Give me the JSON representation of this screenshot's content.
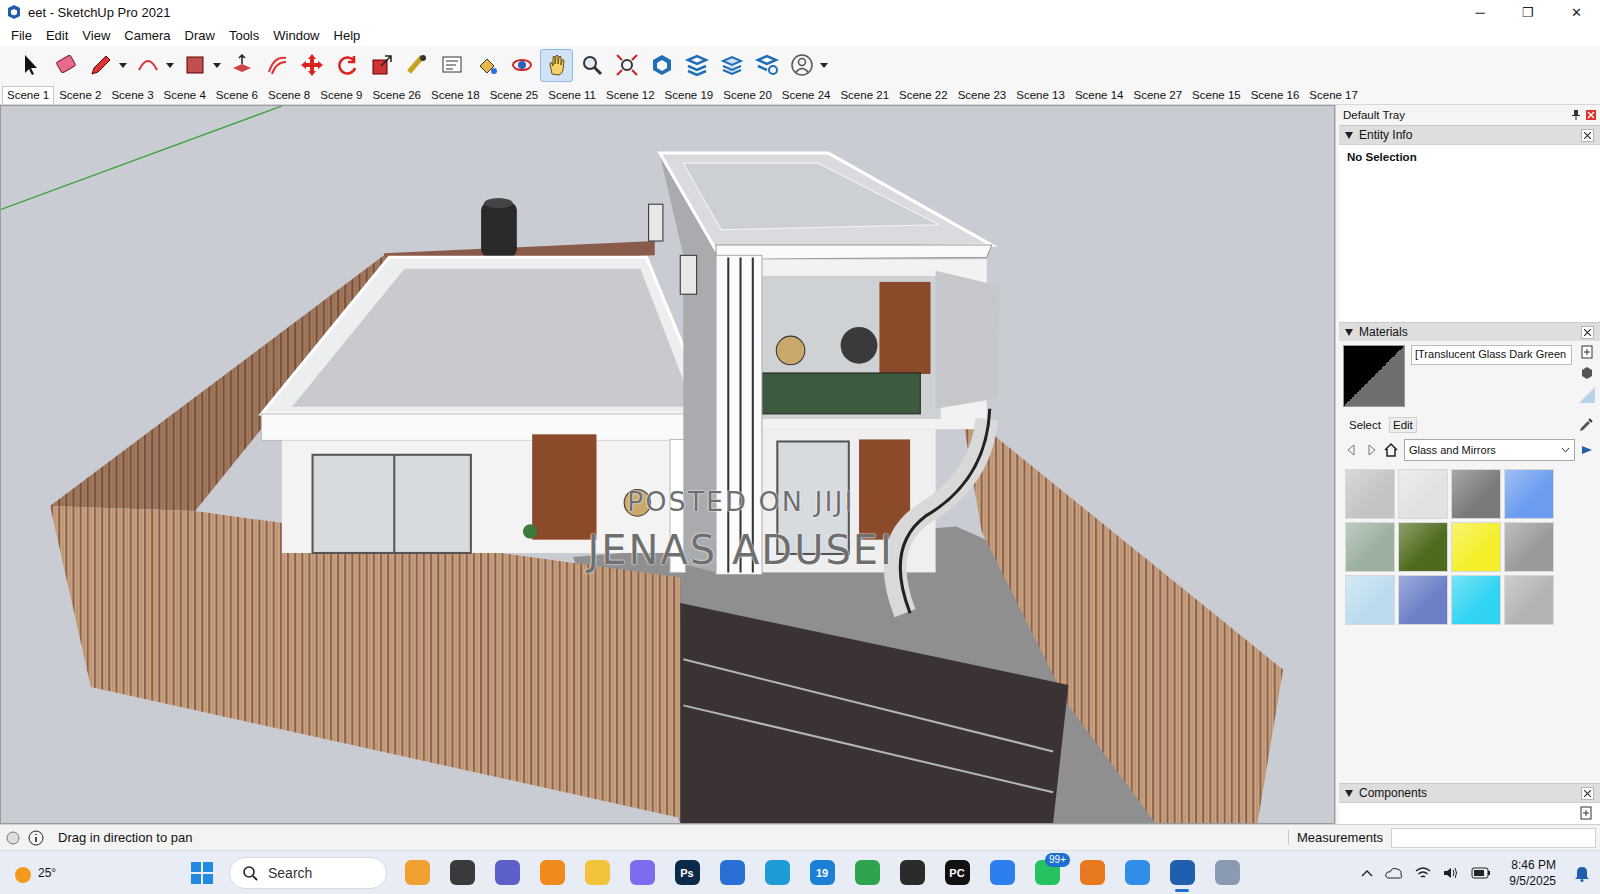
{
  "window": {
    "title": "eet - SketchUp Pro 2021",
    "controls": [
      "─",
      "❐",
      "✕"
    ]
  },
  "menu": [
    "File",
    "Edit",
    "View",
    "Camera",
    "Draw",
    "Tools",
    "Window",
    "Help"
  ],
  "toolbar": {
    "tools": [
      {
        "kind": "select",
        "selected": false,
        "has_menu": false
      },
      {
        "kind": "eraser",
        "selected": false,
        "has_menu": false
      },
      {
        "kind": "pencil",
        "selected": false,
        "has_menu": true
      },
      {
        "kind": "arc",
        "selected": false,
        "has_menu": true
      },
      {
        "kind": "rectangle",
        "selected": false,
        "has_menu": true
      },
      {
        "kind": "pushpull",
        "selected": false,
        "has_menu": false
      },
      {
        "kind": "offset",
        "selected": false,
        "has_menu": false
      },
      {
        "kind": "move",
        "selected": false,
        "has_menu": false
      },
      {
        "kind": "rotate",
        "selected": false,
        "has_menu": false
      },
      {
        "kind": "scale",
        "selected": false,
        "has_menu": false
      },
      {
        "kind": "tape",
        "selected": false,
        "has_menu": false
      },
      {
        "kind": "text",
        "selected": false,
        "has_menu": false
      },
      {
        "kind": "paint",
        "selected": false,
        "has_menu": false
      },
      {
        "kind": "orbit",
        "selected": false,
        "has_menu": false
      },
      {
        "kind": "pan",
        "selected": true,
        "has_menu": false
      },
      {
        "kind": "zoom",
        "selected": false,
        "has_menu": false
      },
      {
        "kind": "zoom-extents",
        "selected": false,
        "has_menu": false
      },
      {
        "kind": "warehouse",
        "selected": false,
        "has_menu": false
      },
      {
        "kind": "extensions",
        "selected": false,
        "has_menu": false
      },
      {
        "kind": "layers",
        "selected": false,
        "has_menu": false
      },
      {
        "kind": "extension-manager",
        "selected": false,
        "has_menu": false
      },
      {
        "kind": "account",
        "selected": false,
        "has_menu": true
      }
    ]
  },
  "scenes": [
    {
      "label": "Scene 1",
      "selected": true
    },
    {
      "label": "Scene 2",
      "selected": false
    },
    {
      "label": "Scene 3",
      "selected": false
    },
    {
      "label": "Scene 4",
      "selected": false
    },
    {
      "label": "Scene 6",
      "selected": false
    },
    {
      "label": "Scene 8",
      "selected": false
    },
    {
      "label": "Scene 9",
      "selected": false
    },
    {
      "label": "Scene 26",
      "selected": false
    },
    {
      "label": "Scene 18",
      "selected": false
    },
    {
      "label": "Scene 25",
      "selected": false
    },
    {
      "label": "Scene 11",
      "selected": false
    },
    {
      "label": "Scene 12",
      "selected": false
    },
    {
      "label": "Scene 19",
      "selected": false
    },
    {
      "label": "Scene 20",
      "selected": false
    },
    {
      "label": "Scene 24",
      "selected": false
    },
    {
      "label": "Scene 21",
      "selected": false
    },
    {
      "label": "Scene 22",
      "selected": false
    },
    {
      "label": "Scene 23",
      "selected": false
    },
    {
      "label": "Scene 13",
      "selected": false
    },
    {
      "label": "Scene 14",
      "selected": false
    },
    {
      "label": "Scene 27",
      "selected": false
    },
    {
      "label": "Scene 15",
      "selected": false
    },
    {
      "label": "Scene 16",
      "selected": false
    },
    {
      "label": "Scene 17",
      "selected": false
    }
  ],
  "watermark": [
    "POSTED ON JIJI",
    "JENAS ADUSEI"
  ],
  "tray": {
    "title": "Default Tray",
    "entity_info": {
      "title": "Entity Info",
      "selection": "No Selection"
    },
    "materials": {
      "title": "Materials",
      "current": "[Translucent Glass Dark Green",
      "tabs": [
        {
          "label": "Select",
          "selected": true
        },
        {
          "label": "Edit",
          "selected": false
        }
      ],
      "library": "Glass and Mirrors",
      "swatches": [
        {
          "color": "#c4c4c4"
        },
        {
          "color": "#e2e2e2"
        },
        {
          "color": "#7a7a7a"
        },
        {
          "color": "#6c9cf0"
        },
        {
          "color": "#9bb09f"
        },
        {
          "color": "#4e6b1d"
        },
        {
          "color": "#f4ef2a"
        },
        {
          "color": "#9a9a9a"
        },
        {
          "color": "#bcdcee"
        },
        {
          "color": "#6b7ec6"
        },
        {
          "color": "#31d3f2"
        },
        {
          "color": "#b3b3b3"
        }
      ]
    },
    "components": {
      "title": "Components"
    }
  },
  "status_bar": {
    "hint": "Drag in direction to pan",
    "measurements_label": "Measurements"
  },
  "taskbar": {
    "weather": "25°",
    "search": "Search",
    "apps": [
      {
        "kind": "people",
        "color": "#f0a030",
        "label": "",
        "selected": false,
        "badge": ""
      },
      {
        "kind": "task-view",
        "color": "#3a3a3a",
        "label": "",
        "selected": false,
        "badge": ""
      },
      {
        "kind": "meet",
        "color": "#5b5fc7",
        "label": "",
        "selected": false,
        "badge": ""
      },
      {
        "kind": "vlc",
        "color": "#f08a1c",
        "label": "",
        "selected": false,
        "badge": ""
      },
      {
        "kind": "file-explorer",
        "color": "#f3c33b",
        "label": "",
        "selected": false,
        "badge": ""
      },
      {
        "kind": "copilot",
        "color": "#7e6cf0",
        "label": "",
        "selected": false,
        "badge": ""
      },
      {
        "kind": "photoshop",
        "color": "#0b2a4a",
        "label": "Ps",
        "selected": false,
        "badge": ""
      },
      {
        "kind": "store",
        "color": "#2a6fd6",
        "label": "",
        "selected": false,
        "badge": ""
      },
      {
        "kind": "edge",
        "color": "#1f9bd8",
        "label": "",
        "selected": false,
        "badge": ""
      },
      {
        "kind": "calendar",
        "color": "#1c7fd6",
        "label": "19",
        "selected": false,
        "badge": ""
      },
      {
        "kind": "chrome",
        "color": "#2fa44f",
        "label": "",
        "selected": false,
        "badge": ""
      },
      {
        "kind": "obs",
        "color": "#2b2b2b",
        "label": "",
        "selected": false,
        "badge": ""
      },
      {
        "kind": "pycharm",
        "color": "#111111",
        "label": "PC",
        "selected": false,
        "badge": ""
      },
      {
        "kind": "todo",
        "color": "#2d7ff0",
        "label": "",
        "selected": false,
        "badge": ""
      },
      {
        "kind": "whatsapp",
        "color": "#25c25f",
        "label": "",
        "selected": false,
        "badge": "99+"
      },
      {
        "kind": "blender",
        "color": "#e8791f",
        "label": "",
        "selected": false,
        "badge": ""
      },
      {
        "kind": "photos",
        "color": "#2f8ee8",
        "label": "",
        "selected": false,
        "badge": ""
      },
      {
        "kind": "sketchup",
        "color": "#1f5fae",
        "label": "",
        "selected": true,
        "badge": ""
      },
      {
        "kind": "snipping",
        "color": "#8a9ab0",
        "label": "",
        "selected": false,
        "badge": ""
      }
    ],
    "clock": {
      "time": "8:46 PM",
      "date": "9/5/2025"
    }
  }
}
